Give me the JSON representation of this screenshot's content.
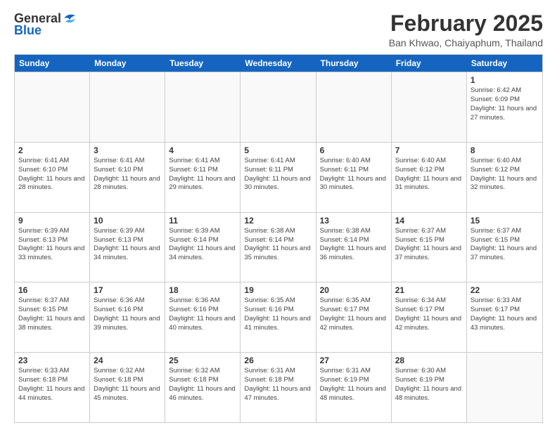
{
  "header": {
    "logo_general": "General",
    "logo_blue": "Blue",
    "month": "February 2025",
    "location": "Ban Khwao, Chaiyaphum, Thailand"
  },
  "weekdays": [
    "Sunday",
    "Monday",
    "Tuesday",
    "Wednesday",
    "Thursday",
    "Friday",
    "Saturday"
  ],
  "rows": [
    [
      {
        "day": "",
        "info": ""
      },
      {
        "day": "",
        "info": ""
      },
      {
        "day": "",
        "info": ""
      },
      {
        "day": "",
        "info": ""
      },
      {
        "day": "",
        "info": ""
      },
      {
        "day": "",
        "info": ""
      },
      {
        "day": "1",
        "info": "Sunrise: 6:42 AM\nSunset: 6:09 PM\nDaylight: 11 hours and 27 minutes."
      }
    ],
    [
      {
        "day": "2",
        "info": "Sunrise: 6:41 AM\nSunset: 6:10 PM\nDaylight: 11 hours and 28 minutes."
      },
      {
        "day": "3",
        "info": "Sunrise: 6:41 AM\nSunset: 6:10 PM\nDaylight: 11 hours and 28 minutes."
      },
      {
        "day": "4",
        "info": "Sunrise: 6:41 AM\nSunset: 6:11 PM\nDaylight: 11 hours and 29 minutes."
      },
      {
        "day": "5",
        "info": "Sunrise: 6:41 AM\nSunset: 6:11 PM\nDaylight: 11 hours and 30 minutes."
      },
      {
        "day": "6",
        "info": "Sunrise: 6:40 AM\nSunset: 6:11 PM\nDaylight: 11 hours and 30 minutes."
      },
      {
        "day": "7",
        "info": "Sunrise: 6:40 AM\nSunset: 6:12 PM\nDaylight: 11 hours and 31 minutes."
      },
      {
        "day": "8",
        "info": "Sunrise: 6:40 AM\nSunset: 6:12 PM\nDaylight: 11 hours and 32 minutes."
      }
    ],
    [
      {
        "day": "9",
        "info": "Sunrise: 6:39 AM\nSunset: 6:13 PM\nDaylight: 11 hours and 33 minutes."
      },
      {
        "day": "10",
        "info": "Sunrise: 6:39 AM\nSunset: 6:13 PM\nDaylight: 11 hours and 34 minutes."
      },
      {
        "day": "11",
        "info": "Sunrise: 6:39 AM\nSunset: 6:14 PM\nDaylight: 11 hours and 34 minutes."
      },
      {
        "day": "12",
        "info": "Sunrise: 6:38 AM\nSunset: 6:14 PM\nDaylight: 11 hours and 35 minutes."
      },
      {
        "day": "13",
        "info": "Sunrise: 6:38 AM\nSunset: 6:14 PM\nDaylight: 11 hours and 36 minutes."
      },
      {
        "day": "14",
        "info": "Sunrise: 6:37 AM\nSunset: 6:15 PM\nDaylight: 11 hours and 37 minutes."
      },
      {
        "day": "15",
        "info": "Sunrise: 6:37 AM\nSunset: 6:15 PM\nDaylight: 11 hours and 37 minutes."
      }
    ],
    [
      {
        "day": "16",
        "info": "Sunrise: 6:37 AM\nSunset: 6:15 PM\nDaylight: 11 hours and 38 minutes."
      },
      {
        "day": "17",
        "info": "Sunrise: 6:36 AM\nSunset: 6:16 PM\nDaylight: 11 hours and 39 minutes."
      },
      {
        "day": "18",
        "info": "Sunrise: 6:36 AM\nSunset: 6:16 PM\nDaylight: 11 hours and 40 minutes."
      },
      {
        "day": "19",
        "info": "Sunrise: 6:35 AM\nSunset: 6:16 PM\nDaylight: 11 hours and 41 minutes."
      },
      {
        "day": "20",
        "info": "Sunrise: 6:35 AM\nSunset: 6:17 PM\nDaylight: 11 hours and 42 minutes."
      },
      {
        "day": "21",
        "info": "Sunrise: 6:34 AM\nSunset: 6:17 PM\nDaylight: 11 hours and 42 minutes."
      },
      {
        "day": "22",
        "info": "Sunrise: 6:33 AM\nSunset: 6:17 PM\nDaylight: 11 hours and 43 minutes."
      }
    ],
    [
      {
        "day": "23",
        "info": "Sunrise: 6:33 AM\nSunset: 6:18 PM\nDaylight: 11 hours and 44 minutes."
      },
      {
        "day": "24",
        "info": "Sunrise: 6:32 AM\nSunset: 6:18 PM\nDaylight: 11 hours and 45 minutes."
      },
      {
        "day": "25",
        "info": "Sunrise: 6:32 AM\nSunset: 6:18 PM\nDaylight: 11 hours and 46 minutes."
      },
      {
        "day": "26",
        "info": "Sunrise: 6:31 AM\nSunset: 6:18 PM\nDaylight: 11 hours and 47 minutes."
      },
      {
        "day": "27",
        "info": "Sunrise: 6:31 AM\nSunset: 6:19 PM\nDaylight: 11 hours and 48 minutes."
      },
      {
        "day": "28",
        "info": "Sunrise: 6:30 AM\nSunset: 6:19 PM\nDaylight: 11 hours and 48 minutes."
      },
      {
        "day": "",
        "info": ""
      }
    ]
  ]
}
